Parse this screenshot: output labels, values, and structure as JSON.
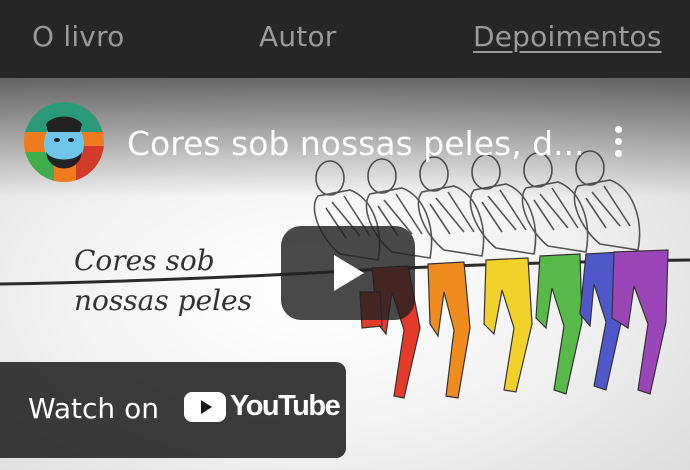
{
  "nav": {
    "items": [
      {
        "label": "O livro"
      },
      {
        "label": "Autor"
      },
      {
        "label": "Depoimentos"
      }
    ]
  },
  "video": {
    "title": "Cores sob nossas peles, d...",
    "thumbnail_text_line1": "Cores sob",
    "thumbnail_text_line2": "nossas peles",
    "watch_on_label": "Watch on",
    "youtube_label": "YouTube",
    "play_icon": "play-icon",
    "menu_icon": "kebab-menu-icon"
  },
  "colors": {
    "nav_bg": "#262626",
    "nav_text": "#9a9a9a",
    "legs": [
      "#e63a2a",
      "#f08c1e",
      "#f2d12b",
      "#57b947",
      "#4f58c9",
      "#9b46b8"
    ],
    "youtube_red": "#ff0000"
  }
}
